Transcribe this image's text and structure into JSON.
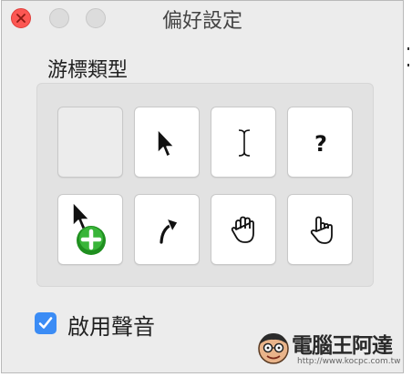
{
  "window": {
    "title": "偏好設定"
  },
  "section": {
    "label": "游標類型"
  },
  "cursors": [
    {
      "name": "blank-cursor",
      "icon": "blank"
    },
    {
      "name": "arrow-cursor",
      "icon": "arrow-pointer-icon"
    },
    {
      "name": "ibeam-cursor",
      "icon": "text-ibeam-icon"
    },
    {
      "name": "help-cursor",
      "icon": "question-mark-icon"
    },
    {
      "name": "copy-cursor",
      "icon": "arrow-plus-badge-icon"
    },
    {
      "name": "alias-cursor",
      "icon": "curved-arrow-icon"
    },
    {
      "name": "open-hand-cursor",
      "icon": "open-hand-icon"
    },
    {
      "name": "pointing-hand-cursor",
      "icon": "pointing-hand-icon"
    }
  ],
  "option": {
    "label": "啟用聲音",
    "checked": true
  },
  "watermark": {
    "title": "電腦王阿達",
    "url": "http://www.kocpc.com.tw"
  },
  "colors": {
    "accent": "#3b8cf5",
    "close": "#fc5753",
    "plus_badge": "#2faa2f"
  }
}
